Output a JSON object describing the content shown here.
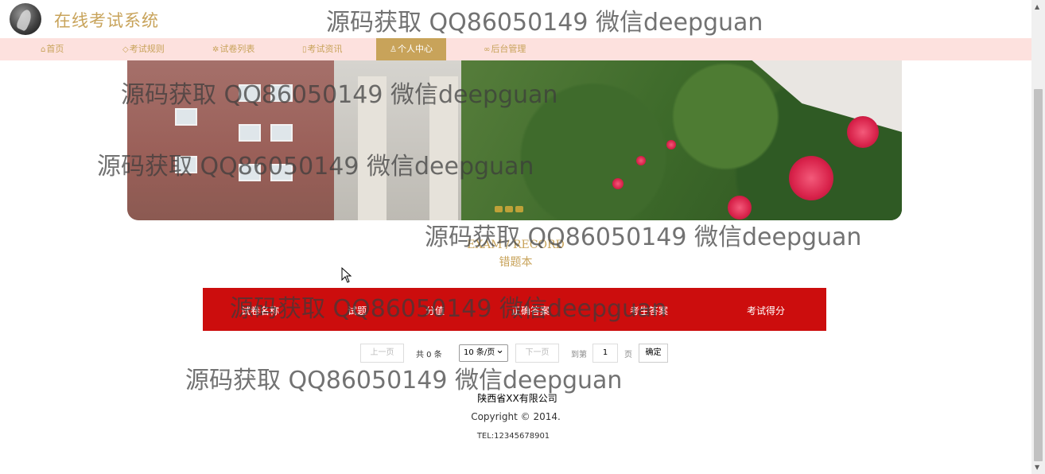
{
  "header": {
    "site_title": "在线考试系统",
    "logo_icon": "logo-icon"
  },
  "nav": [
    {
      "label": "首页",
      "icon": "home-icon",
      "glyph": "⌂",
      "active": false
    },
    {
      "label": "考试规则",
      "icon": "tag-icon",
      "glyph": "◇",
      "active": false
    },
    {
      "label": "试卷列表",
      "icon": "gear-icon",
      "glyph": "✲",
      "active": false
    },
    {
      "label": "考试资讯",
      "icon": "document-icon",
      "glyph": "▯",
      "active": false
    },
    {
      "label": "个人中心",
      "icon": "user-icon",
      "glyph": "♙",
      "active": true
    },
    {
      "label": "后台管理",
      "icon": "link-icon",
      "glyph": "∞",
      "active": false
    }
  ],
  "section": {
    "title_en": "EXAM / RECORD",
    "title_cn": "错题本"
  },
  "table": {
    "columns": [
      "试卷名称",
      "试题",
      "分值",
      "正确答案",
      "考生答案",
      "考试得分"
    ],
    "rows": []
  },
  "pager": {
    "prev": "上一页",
    "total": "共 0 条",
    "page_size": "10 条/页",
    "next": "下一页",
    "goto_label": "到第",
    "page_input": "1",
    "page_unit": "页",
    "confirm": "确定"
  },
  "footer": {
    "company": "陕西省XX有限公司",
    "copyright": "Copyright © 2014.",
    "tel": "TEL:12345678901"
  },
  "watermark": "源码获取 QQ86050149 微信deepguan",
  "colors": {
    "accent": "#c8a35a",
    "nav_bg": "#fde1de",
    "table_head": "#cc0d0d"
  }
}
